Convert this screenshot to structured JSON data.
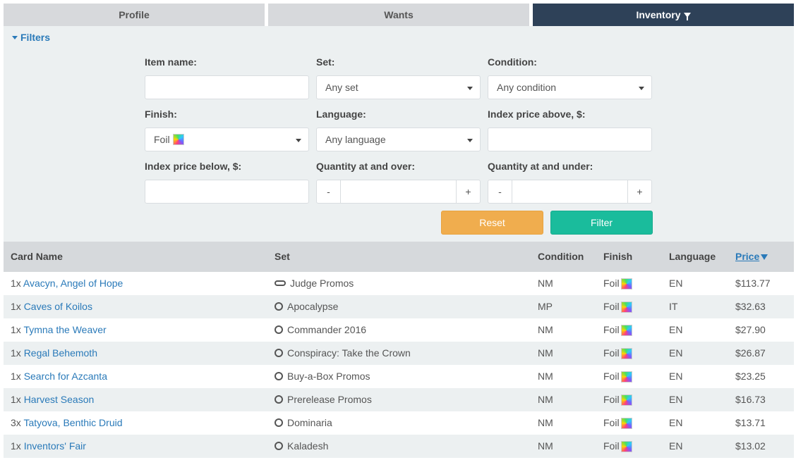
{
  "tabs": [
    {
      "label": "Profile"
    },
    {
      "label": "Wants"
    },
    {
      "label": "Inventory"
    }
  ],
  "filters": {
    "toggle_label": "Filters",
    "item_name_label": "Item name:",
    "item_name_value": "",
    "set_label": "Set:",
    "set_value": "Any set",
    "condition_label": "Condition:",
    "condition_value": "Any condition",
    "finish_label": "Finish:",
    "finish_value": "Foil",
    "language_label": "Language:",
    "language_value": "Any language",
    "index_above_label": "Index price above, $:",
    "index_above_value": "",
    "index_below_label": "Index price below, $:",
    "index_below_value": "",
    "qty_over_label": "Quantity at and over:",
    "qty_under_label": "Quantity at and under:",
    "minus": "-",
    "plus": "+",
    "reset_label": "Reset",
    "filter_label": "Filter"
  },
  "table": {
    "headers": {
      "card_name": "Card Name",
      "set": "Set",
      "condition": "Condition",
      "finish": "Finish",
      "language": "Language",
      "price": "Price"
    },
    "rows": [
      {
        "qty": "1x",
        "name": "Avacyn, Angel of Hope",
        "set": "Judge Promos",
        "condition": "NM",
        "finish": "Foil",
        "language": "EN",
        "price": "$113.77"
      },
      {
        "qty": "1x",
        "name": "Caves of Koilos",
        "set": "Apocalypse",
        "condition": "MP",
        "finish": "Foil",
        "language": "IT",
        "price": "$32.63"
      },
      {
        "qty": "1x",
        "name": "Tymna the Weaver",
        "set": "Commander 2016",
        "condition": "NM",
        "finish": "Foil",
        "language": "EN",
        "price": "$27.90"
      },
      {
        "qty": "1x",
        "name": "Regal Behemoth",
        "set": "Conspiracy: Take the Crown",
        "condition": "NM",
        "finish": "Foil",
        "language": "EN",
        "price": "$26.87"
      },
      {
        "qty": "1x",
        "name": "Search for Azcanta",
        "set": "Buy-a-Box Promos",
        "condition": "NM",
        "finish": "Foil",
        "language": "EN",
        "price": "$23.25"
      },
      {
        "qty": "1x",
        "name": "Harvest Season",
        "set": "Prerelease Promos",
        "condition": "NM",
        "finish": "Foil",
        "language": "EN",
        "price": "$16.73"
      },
      {
        "qty": "3x",
        "name": "Tatyova, Benthic Druid",
        "set": "Dominaria",
        "condition": "NM",
        "finish": "Foil",
        "language": "EN",
        "price": "$13.71"
      },
      {
        "qty": "1x",
        "name": "Inventors' Fair",
        "set": "Kaladesh",
        "condition": "NM",
        "finish": "Foil",
        "language": "EN",
        "price": "$13.02"
      }
    ]
  },
  "colors": {
    "tab_active": "#2e4158",
    "tab_inactive": "#d7d9dc",
    "link": "#2a7ab9",
    "reset": "#f0ad4e",
    "filter": "#1abc9c",
    "panel": "#ecf0f1"
  },
  "icons": {
    "inventory_tab": "funnel-icon",
    "finish": "foil-rainbow-icon",
    "sort": "sort-down-icon"
  }
}
